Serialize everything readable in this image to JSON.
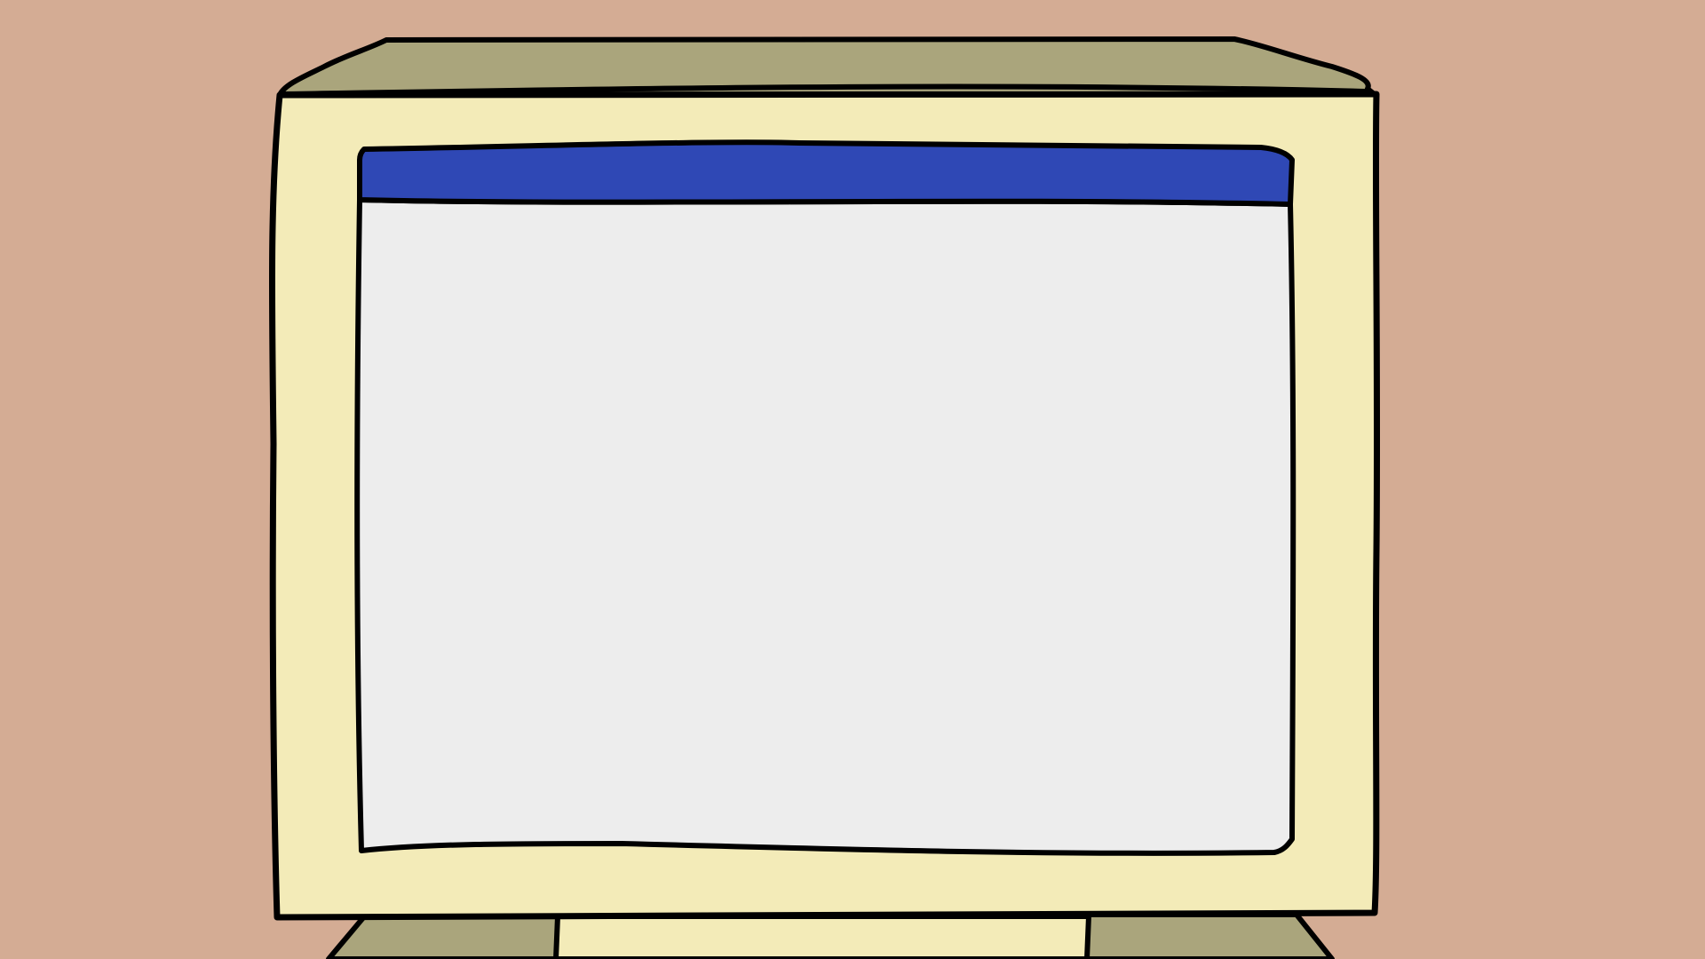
{
  "colors": {
    "background": "#d4ac94",
    "monitor_body": "#f3ebb8",
    "monitor_top": "#aaa57c",
    "screen_titlebar": "#2f48b5",
    "screen_content": "#ededed",
    "outline": "#000000"
  },
  "icons": {
    "monitor": "crt-monitor-icon"
  }
}
